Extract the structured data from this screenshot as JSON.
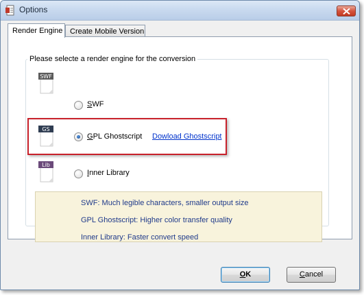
{
  "window": {
    "title": "Options"
  },
  "tabs": [
    {
      "label": "Render Engine",
      "active": true
    },
    {
      "label": "Create Mobile Version",
      "active": false
    }
  ],
  "group": {
    "label": "Please selecte a render engine for the conversion"
  },
  "engines": [
    {
      "icon_text": "SWF",
      "label": "SWF",
      "mnemonic": "S",
      "rest": "WF",
      "checked": false
    },
    {
      "icon_text": "GS",
      "label": "GPL Ghostscript",
      "mnemonic": "G",
      "rest": "PL Ghostscript",
      "checked": true,
      "link": "Dowload Ghostscript"
    },
    {
      "icon_text": "Lib",
      "label": "Inner Library",
      "mnemonic": "I",
      "rest": "nner Library",
      "checked": false
    }
  ],
  "info": [
    "SWF: Much legible characters, smaller output size",
    "GPL Ghostscript: Higher color transfer quality",
    "Inner Library: Faster convert speed"
  ],
  "buttons": {
    "ok": {
      "label": "OK",
      "mnemonic": "O",
      "rest": "K"
    },
    "cancel": {
      "label": "Cancel",
      "mnemonic": "C",
      "rest": "ancel"
    }
  },
  "colors": {
    "highlight_border": "#c8202a",
    "link": "#0033cc",
    "info_bg": "#f8f3dc"
  },
  "icons": [
    "app-icon",
    "close-icon",
    "swf-file-icon",
    "gs-file-icon",
    "lib-file-icon"
  ]
}
